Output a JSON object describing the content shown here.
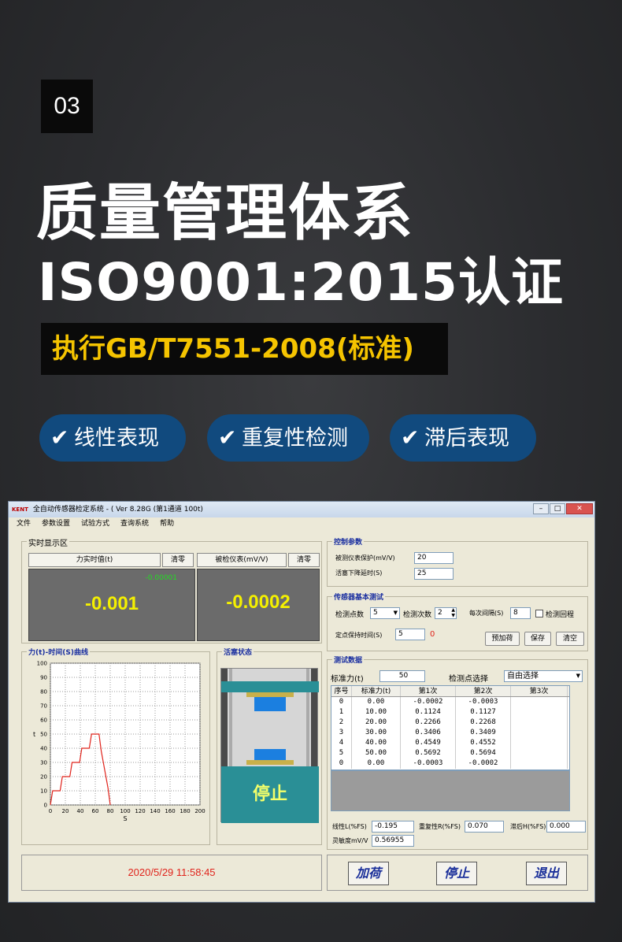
{
  "section_number": "03",
  "headline": {
    "line1": "质量管理体系",
    "line2": "ISO9001:2015认证",
    "standard": "执行GB/T7551-2008(标准)"
  },
  "features": [
    "线性表现",
    "重复性检测",
    "滞后表现"
  ],
  "check_glyph": "✔",
  "window": {
    "logo": "KENT",
    "title": "全自动传感器检定系统 - ( Ver 8.28G (第1通道  100t)",
    "menu": [
      "文件",
      "参数设置",
      "试验方式",
      "查询系统",
      "帮助"
    ],
    "realtime": {
      "group_title": "实时显示区",
      "force_header": "力实时值(t)",
      "clear1": "清零",
      "meter_header": "被检仪表(mV/V)",
      "clear2": "清零",
      "force_small": "-0.00001",
      "force_value": "-0.001",
      "meter_value": "-0.0002"
    },
    "control": {
      "group_title": "控制参数",
      "protect_label": "被测仪表保护(mV/V)",
      "protect_value": "20",
      "delay_label": "活塞下降延时(S)",
      "delay_value": "25"
    },
    "basic_test": {
      "group_title": "传感器基本测试",
      "points_label": "检测点数",
      "points_value": "5",
      "times_label": "检测次数",
      "times_value": "2",
      "interval_label": "每次间隔(S)",
      "interval_value": "8",
      "return_label": "检测回程",
      "hold_label": "定点保持时间(S)",
      "hold_value": "5",
      "hold_status": "0",
      "btn_preload": "预加荷",
      "btn_save": "保存",
      "btn_clear": "清空"
    },
    "curve": {
      "group_title": "力(t)-时间(S)曲线",
      "ylabel": "t",
      "xlabel": "S"
    },
    "piston": {
      "group_title": "活塞状态",
      "status": "停止"
    },
    "test_data": {
      "group_title": "测试数据",
      "std_force_label": "标准力(t)",
      "std_force_value": "50",
      "select_label": "检测点选择",
      "select_value": "自由选择",
      "columns": [
        "序号",
        "标准力(t)",
        "第1次",
        "第2次",
        "第3次"
      ],
      "rows": [
        [
          "0",
          "0.00",
          "-0.0002",
          "-0.0003",
          ""
        ],
        [
          "1",
          "10.00",
          "0.1124",
          "0.1127",
          ""
        ],
        [
          "2",
          "20.00",
          "0.2266",
          "0.2268",
          ""
        ],
        [
          "3",
          "30.00",
          "0.3406",
          "0.3409",
          ""
        ],
        [
          "4",
          "40.00",
          "0.4549",
          "0.4552",
          ""
        ],
        [
          "5",
          "50.00",
          "0.5692",
          "0.5694",
          ""
        ],
        [
          "0",
          "0.00",
          "-0.0003",
          "-0.0002",
          ""
        ]
      ],
      "linearity_label": "线性L(%FS)",
      "linearity_value": "-0.195",
      "repeat_label": "重复性R(%FS)",
      "repeat_value": "0.070",
      "hysteresis_label": "滞后H(%FS)",
      "hysteresis_value": "0.000",
      "sensitivity_label": "灵敏度mV/V",
      "sensitivity_value": "0.56955"
    },
    "datetime": "2020/5/29 11:58:45",
    "buttons": {
      "load": "加荷",
      "stop": "停止",
      "exit": "退出"
    },
    "colors": {
      "accent_red": "#e0241c",
      "display_yellow": "#f4f000",
      "pill_blue": "#114a7e",
      "piston_teal": "#2a8f96"
    }
  },
  "chart_data": {
    "type": "line",
    "title": "力(t)-时间(S)曲线",
    "xlabel": "S",
    "ylabel": "t",
    "xlim": [
      0,
      200
    ],
    "ylim": [
      0,
      100
    ],
    "xticks": [
      0,
      20,
      40,
      60,
      80,
      100,
      120,
      140,
      160,
      180,
      200
    ],
    "yticks": [
      0,
      10,
      20,
      30,
      40,
      50,
      60,
      70,
      80,
      90,
      100
    ],
    "grid": true,
    "series": [
      {
        "color": "#e0241c",
        "x": [
          0,
          3,
          13,
          16,
          26,
          29,
          39,
          42,
          52,
          55,
          65,
          68,
          77,
          80
        ],
        "y": [
          0,
          10,
          10,
          20,
          20,
          30,
          30,
          40,
          40,
          50,
          50,
          38,
          12,
          0
        ]
      }
    ]
  }
}
